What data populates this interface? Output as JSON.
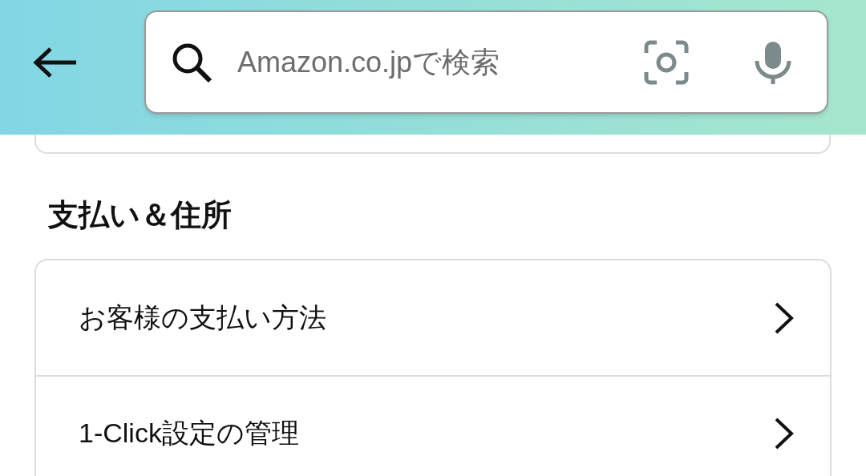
{
  "search": {
    "placeholder": "Amazon.co.jpで検索"
  },
  "section": {
    "title": "支払い＆住所",
    "items": [
      {
        "label": "お客様の支払い方法"
      },
      {
        "label": "1-Click設定の管理"
      }
    ]
  }
}
